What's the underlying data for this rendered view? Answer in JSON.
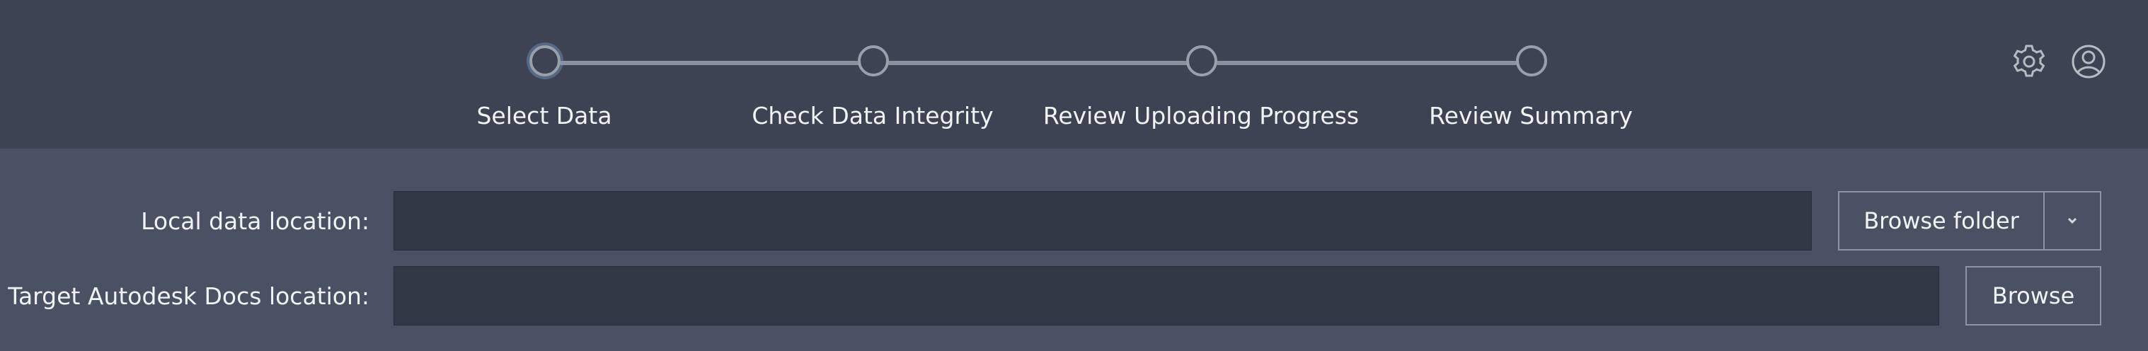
{
  "stepper": {
    "steps": [
      {
        "label": "Select Data",
        "active": true
      },
      {
        "label": "Check Data Integrity",
        "active": false
      },
      {
        "label": "Review Uploading Progress",
        "active": false
      },
      {
        "label": "Review Summary",
        "active": false
      }
    ]
  },
  "header": {
    "icons": [
      "gear-icon",
      "user-account-icon"
    ]
  },
  "form": {
    "local": {
      "label": "Local data location:",
      "value": "",
      "placeholder": "",
      "button_label": "Browse folder",
      "dropdown_icon": "chevron-down-icon"
    },
    "target": {
      "label": "Target Autodesk Docs location:",
      "value": "",
      "placeholder": "",
      "button_label": "Browse"
    }
  },
  "colors": {
    "header_bg": "#3d4352",
    "body_bg": "#4a5162",
    "input_bg": "#313744",
    "step_line": "#8b919d",
    "text": "#f2f3f5"
  }
}
